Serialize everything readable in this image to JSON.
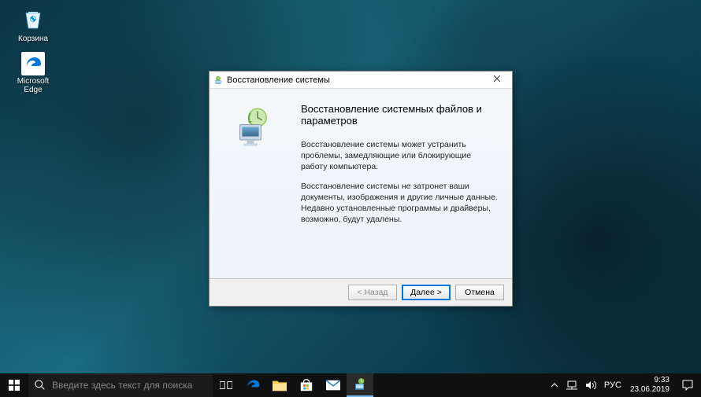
{
  "desktop_icons": {
    "recycle_bin": "Корзина",
    "edge": "Microsoft Edge"
  },
  "dialog": {
    "title": "Восстановление системы",
    "heading": "Восстановление системных файлов и параметров",
    "para1": "Восстановление системы может устранить проблемы, замедляющие или блокирующие работу компьютера.",
    "para2": "Восстановление системы не затронет ваши документы, изображения и другие личные данные. Недавно установленные программы и драйверы, возможно, будут удалены.",
    "btn_back": "< Назад",
    "btn_next": "Далее >",
    "btn_cancel": "Отмена"
  },
  "taskbar": {
    "search_placeholder": "Введите здесь текст для поиска",
    "lang": "РУС",
    "time": "9:33",
    "date": "23.06.2019"
  }
}
